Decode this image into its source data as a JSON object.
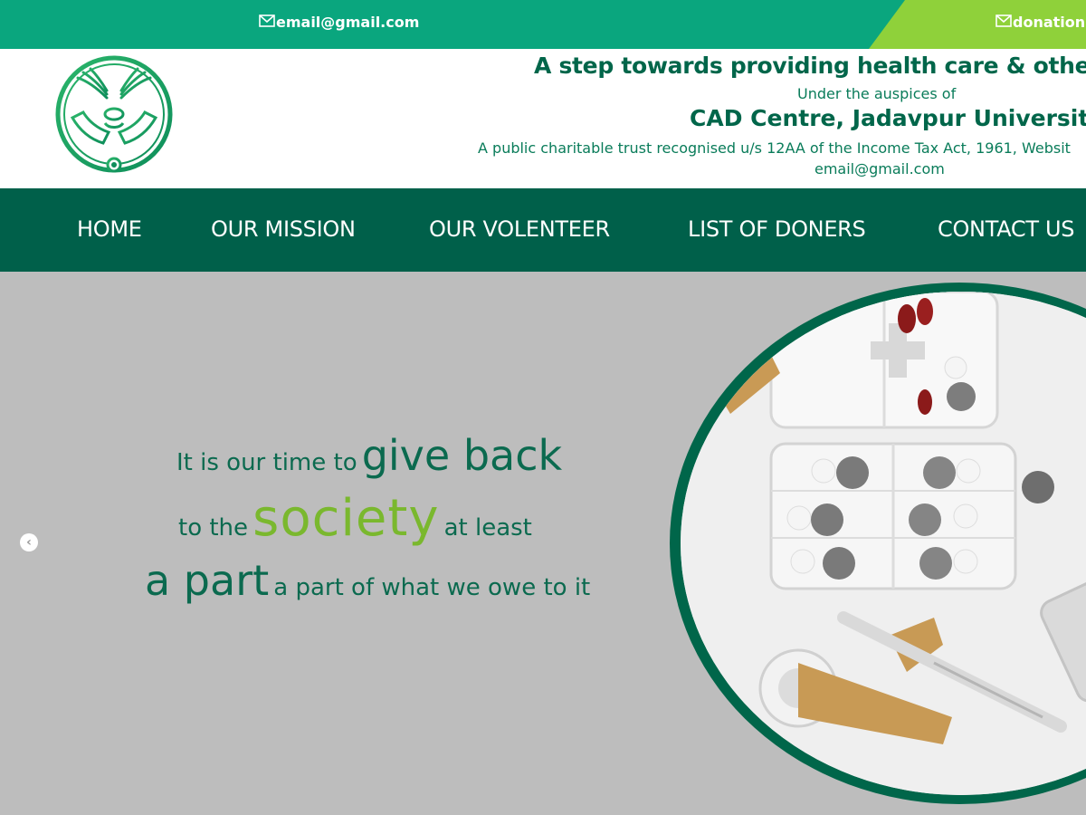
{
  "topbar": {
    "email": "email@gmail.com",
    "donation": "donation",
    "mail_icon": "mail-icon",
    "colors": {
      "primary": "#0aa67e",
      "accent": "#8fd13a"
    }
  },
  "header": {
    "logo_icon": "hands-caduceus-logo",
    "tagline": "A step towards providing health care & other so",
    "auspices": "Under the auspices of",
    "org": "CAD Centre, Jadavpur University",
    "trust": "A public charitable trust recognised u/s 12AA of the Income Tax Act, 1961, Websit",
    "email": "email@gmail.com"
  },
  "nav": {
    "items": [
      {
        "label": "HOME"
      },
      {
        "label": "OUR MISSION"
      },
      {
        "label": "OUR VOLENTEER"
      },
      {
        "label": "LIST OF DONERS"
      },
      {
        "label": "CONTACT US"
      }
    ],
    "color": "#00604a"
  },
  "hero": {
    "line1_small": "It is our time to",
    "line1_big": "give back",
    "line2_small": "to the",
    "line2_big": "society",
    "line2_end": "at least",
    "line3_big": "a part",
    "line3_small": "a part of what we owe to it",
    "prev_icon": "chevron-left-icon",
    "image_icon": "medical-supplies-image"
  }
}
